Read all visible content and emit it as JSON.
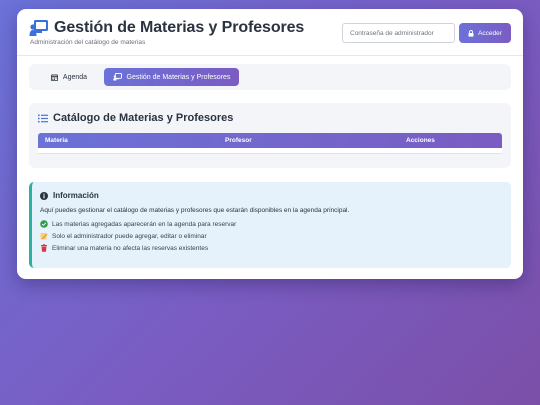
{
  "header": {
    "title": "Gestión de Materias y Profesores",
    "subtitle": "Administración del catálogo de materias",
    "password_placeholder": "Contraseña de administrador",
    "access_label": "Acceder"
  },
  "tabs": [
    {
      "label": "Agenda",
      "active": false
    },
    {
      "label": "Gestión de Materias y Profesores",
      "active": true
    }
  ],
  "catalog": {
    "title": "Catálogo de Materias y Profesores",
    "columns": [
      "Materia",
      "Profesor",
      "Acciones"
    ],
    "rows": []
  },
  "info": {
    "title": "Información",
    "description": "Aquí puedes gestionar el catálogo de materias y profesores que estarán disponibles en la agenda principal.",
    "items": [
      {
        "icon": "check-circle-icon",
        "text": "Las materias agregadas aparecerán en la agenda para reservar"
      },
      {
        "icon": "pencil-icon",
        "text": "Solo el administrador puede agregar, editar o eliminar"
      },
      {
        "icon": "trash-icon",
        "text": "Eliminar una materia no afecta las reservas existentes"
      }
    ]
  },
  "colors": {
    "accent_start": "#6b72d8",
    "accent_end": "#7a5cc2",
    "info_border": "#2ab0a4",
    "info_bg": "#e5f1fb",
    "check_green": "#2e9e4a",
    "trash_red": "#d9363e"
  }
}
